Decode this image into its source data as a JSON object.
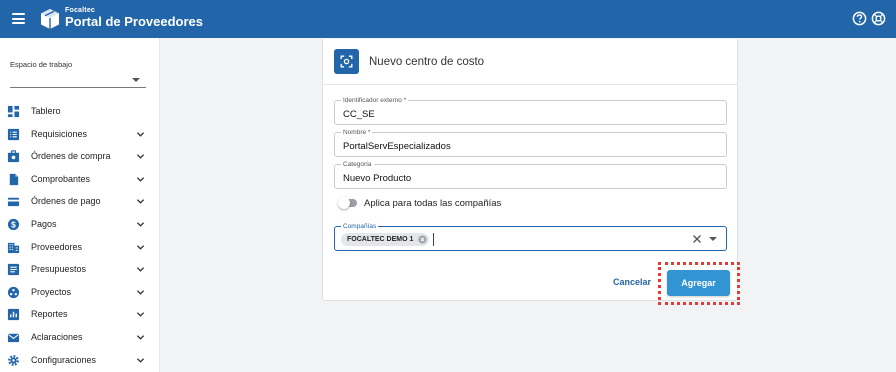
{
  "header": {
    "brand_small": "Focaltec",
    "brand_big": "Portal de Proveedores",
    "bg_color": "#2266a9"
  },
  "sidebar": {
    "workspace_label": "Espacio de trabajo",
    "workspace_value": "",
    "items": [
      {
        "label": "Tablero",
        "icon": "dashboard-icon",
        "has_chevron": false
      },
      {
        "label": "Requisiciones",
        "icon": "list-icon",
        "has_chevron": true
      },
      {
        "label": "Órdenes de compra",
        "icon": "purchase-order-icon",
        "has_chevron": true
      },
      {
        "label": "Comprobantes",
        "icon": "document-icon",
        "has_chevron": true
      },
      {
        "label": "Órdenes de pago",
        "icon": "card-icon",
        "has_chevron": true
      },
      {
        "label": "Pagos",
        "icon": "dollar-icon",
        "has_chevron": true
      },
      {
        "label": "Proveedores",
        "icon": "building-icon",
        "has_chevron": true
      },
      {
        "label": "Presupuestos",
        "icon": "budget-icon",
        "has_chevron": true
      },
      {
        "label": "Proyectos",
        "icon": "projects-icon",
        "has_chevron": true
      },
      {
        "label": "Reportes",
        "icon": "reports-icon",
        "has_chevron": true
      },
      {
        "label": "Aclaraciones",
        "icon": "mail-icon",
        "has_chevron": true
      },
      {
        "label": "Configuraciones",
        "icon": "gear-icon",
        "has_chevron": true
      }
    ]
  },
  "form": {
    "title": "Nuevo centro de costo",
    "fields": {
      "external_id": {
        "label": "Identificador externo *",
        "value": "CC_SE"
      },
      "name": {
        "label": "Nombre *",
        "value": "PortalServEspecializados"
      },
      "category": {
        "label": "Categoría",
        "value": "Nuevo Producto"
      }
    },
    "toggle_label": "Aplica para todas las compañías",
    "toggle_on": false,
    "companies": {
      "label": "Compañías",
      "chips": [
        "FOCALTEC DEMO 1"
      ]
    },
    "cancel_label": "Cancelar",
    "add_label": "Agregar"
  },
  "colors": {
    "primary": "#2266a9",
    "button": "#3394d3",
    "highlight": "#e53935"
  }
}
